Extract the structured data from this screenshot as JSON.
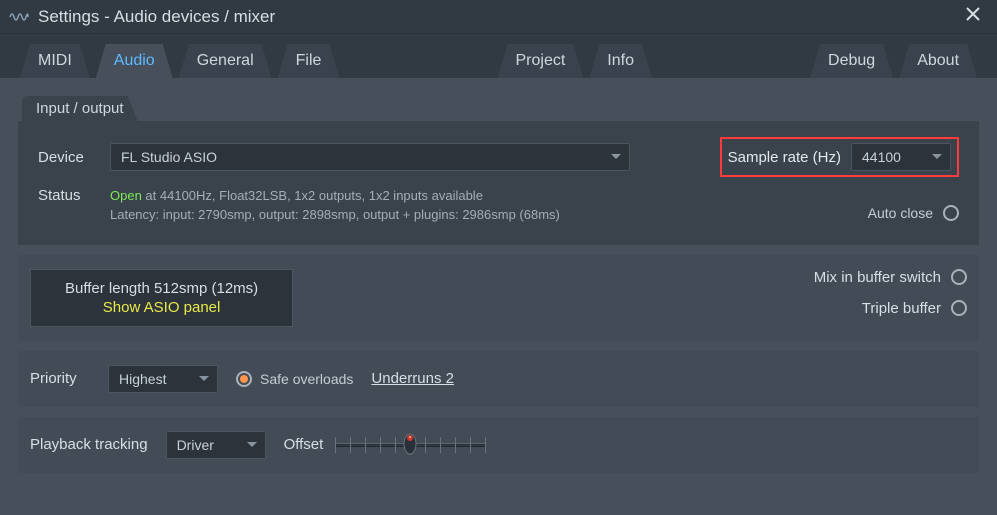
{
  "titlebar": {
    "title": "Settings - Audio devices / mixer"
  },
  "tabs": {
    "midi": "MIDI",
    "audio": "Audio",
    "general": "General",
    "file": "File",
    "project": "Project",
    "info": "Info",
    "debug": "Debug",
    "about": "About",
    "active": "audio"
  },
  "io": {
    "section_label": "Input / output",
    "device_label": "Device",
    "device_value": "FL Studio ASIO",
    "sample_rate_label": "Sample rate (Hz)",
    "sample_rate_value": "44100",
    "status_label": "Status",
    "status_open_word": "Open",
    "status_line1_rest": " at 44100Hz, Float32LSB, 1x2 outputs, 1x2 inputs available",
    "status_line2": "Latency: input: 2790smp, output: 2898smp, output + plugins: 2986smp (68ms)",
    "auto_close_label": "Auto close",
    "auto_close_on": false
  },
  "buffer": {
    "length_text": "Buffer length 512smp (12ms)",
    "asio_panel_label": "Show ASIO panel",
    "mix_in_buffer_label": "Mix in buffer switch",
    "mix_in_buffer_on": false,
    "triple_buffer_label": "Triple buffer",
    "triple_buffer_on": false
  },
  "priority": {
    "label": "Priority",
    "value": "Highest",
    "safe_overloads_label": "Safe overloads",
    "safe_overloads_on": true,
    "underruns_label": "Underruns 2"
  },
  "playback": {
    "tracking_label": "Playback tracking",
    "tracking_value": "Driver",
    "offset_label": "Offset",
    "offset_value": 0
  }
}
